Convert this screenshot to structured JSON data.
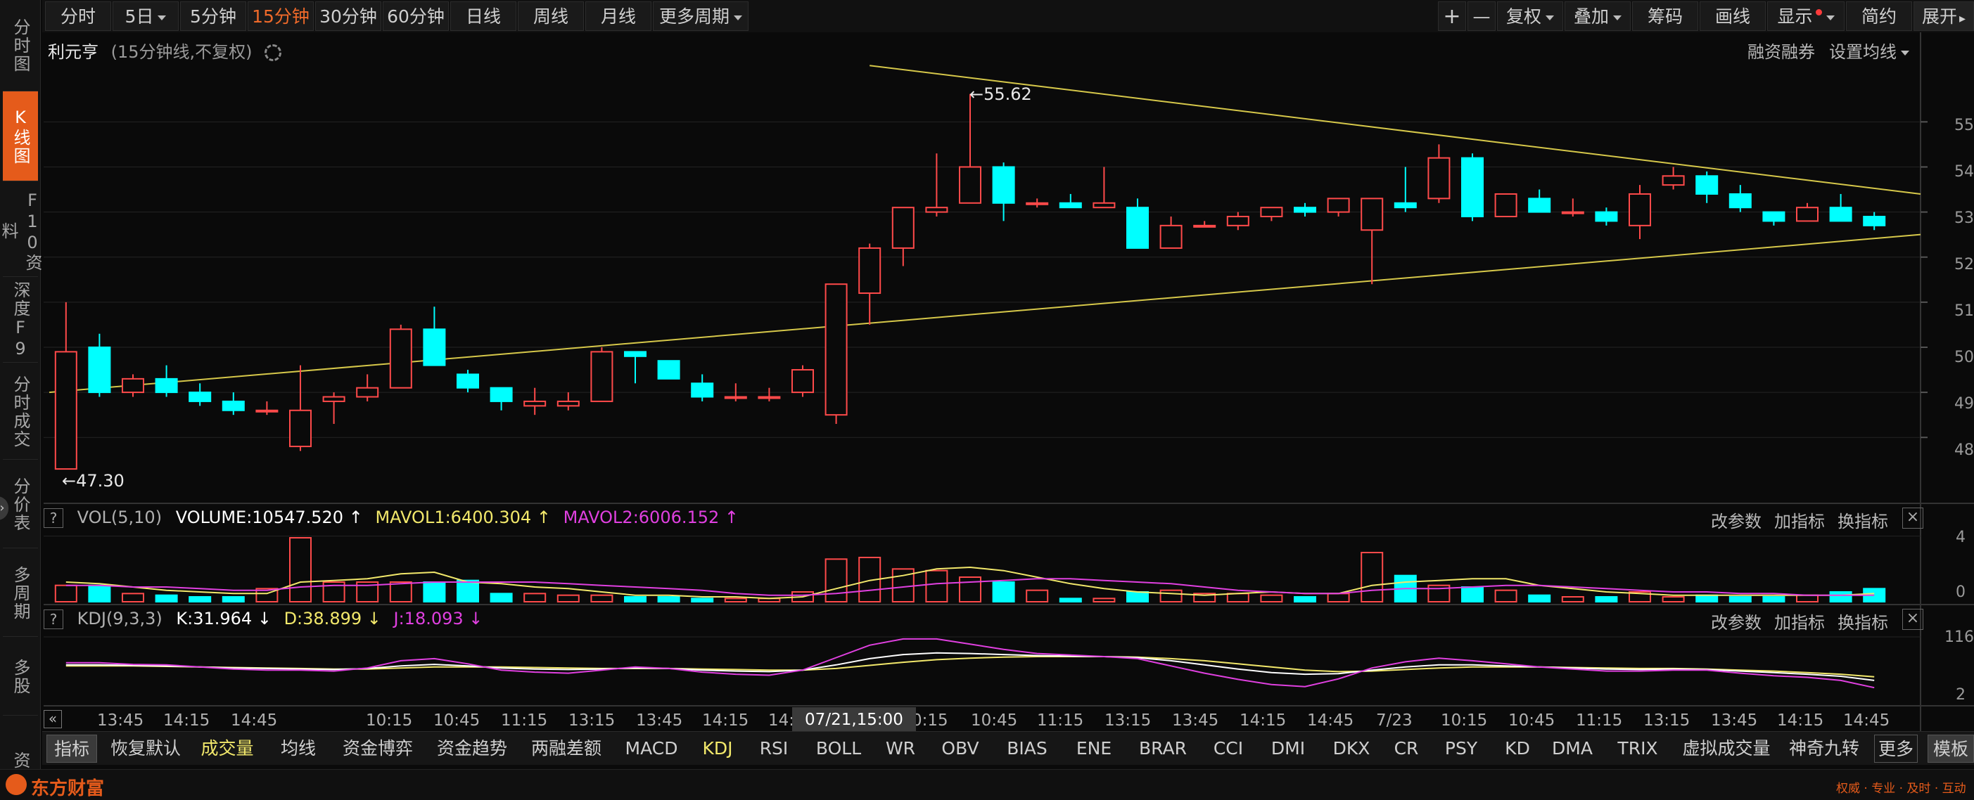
{
  "nav": {
    "items": [
      {
        "label": "分时图"
      },
      {
        "label": "K线图"
      },
      {
        "label": "F10资料"
      },
      {
        "label": "深度F9"
      },
      {
        "label": "分时成交"
      },
      {
        "label": "分价表"
      },
      {
        "label": "多周期"
      },
      {
        "label": "多股"
      },
      {
        "label": "资"
      }
    ]
  },
  "toolbar": {
    "periods": [
      "分时",
      "5日",
      "5分钟",
      "15分钟",
      "30分钟",
      "60分钟",
      "日线",
      "周线",
      "月线",
      "更多周期"
    ],
    "active_period": "15分钟",
    "plus": "+",
    "minus": "—",
    "fuquan": "复权",
    "diejia": "叠加",
    "chouma": "筹码",
    "huaxian": "画线",
    "xianshi": "显示",
    "jianyue": "简约",
    "zhankai": "展开"
  },
  "header": {
    "stock_name": "利元亨",
    "desc": "(15分钟线,不复权)",
    "margin_link": "融资融券",
    "ma_setting": "设置均线"
  },
  "price_axis": [
    "55",
    "54",
    "53",
    "52",
    "51",
    "50",
    "49",
    "48"
  ],
  "annotations": {
    "high": "55.62",
    "low": "47.30"
  },
  "volume_panel": {
    "help": "?",
    "name": "VOL(5,10)",
    "volume": "VOLUME:10547.520",
    "mavol1": "MAVOL1:6400.304",
    "mavol2": "MAVOL2:6006.152",
    "axis_top": "4",
    "axis_bottom": "0",
    "actions": [
      "改参数",
      "加指标",
      "换指标"
    ],
    "close": "×"
  },
  "kdj_panel": {
    "help": "?",
    "name": "KDJ(9,3,3)",
    "k": "K:31.964",
    "d": "D:38.899",
    "j": "J:18.093",
    "axis_top": "116",
    "axis_bottom": "2",
    "actions": [
      "改参数",
      "加指标",
      "换指标"
    ],
    "close": "×"
  },
  "time_axis": {
    "labels": [
      "13:45",
      "14:15",
      "14:45",
      "10:15",
      "10:45",
      "11:15",
      "13:15",
      "13:45",
      "14:15",
      "14:",
      "0:15",
      "10:45",
      "11:15",
      "13:15",
      "13:45",
      "14:15",
      "14:45",
      "7/23",
      "10:15",
      "10:45",
      "11:15",
      "13:15",
      "13:45",
      "14:15",
      "14:45"
    ],
    "cursor_time": "07/21,15:00",
    "collapse": "«"
  },
  "indicators": {
    "items": [
      "指标",
      "恢复默认",
      "成交量",
      "均线",
      "资金博弈",
      "资金趋势",
      "两融差额",
      "MACD",
      "KDJ",
      "RSI",
      "BOLL",
      "WR",
      "OBV",
      "BIAS",
      "ENE",
      "BRAR",
      "CCI",
      "DMI",
      "DKX",
      "CR",
      "PSY",
      "KD",
      "DMA",
      "TRIX",
      "虚拟成交量",
      "神奇九转",
      "更多",
      "模板"
    ]
  },
  "footer": {
    "brand": "东方财富",
    "slogan": "权威 · 专业 · 及时 · 互动"
  },
  "chart_data": {
    "type": "candlestick",
    "interval": "15分钟",
    "ylim": [
      46.6,
      56.3
    ],
    "candles": [
      {
        "o": 47.3,
        "h": 51.0,
        "l": 47.3,
        "c": 49.9
      },
      {
        "o": 50.0,
        "h": 50.3,
        "l": 48.9,
        "c": 49.0
      },
      {
        "o": 49.0,
        "h": 49.4,
        "l": 48.9,
        "c": 49.3
      },
      {
        "o": 49.3,
        "h": 49.6,
        "l": 48.9,
        "c": 49.0
      },
      {
        "o": 49.0,
        "h": 49.2,
        "l": 48.7,
        "c": 48.8
      },
      {
        "o": 48.8,
        "h": 49.0,
        "l": 48.5,
        "c": 48.6
      },
      {
        "o": 48.6,
        "h": 48.8,
        "l": 48.5,
        "c": 48.6
      },
      {
        "o": 47.8,
        "h": 49.6,
        "l": 47.7,
        "c": 48.6
      },
      {
        "o": 48.8,
        "h": 49.0,
        "l": 48.3,
        "c": 48.9
      },
      {
        "o": 48.9,
        "h": 49.4,
        "l": 48.8,
        "c": 49.1
      },
      {
        "o": 49.1,
        "h": 50.5,
        "l": 49.1,
        "c": 50.4
      },
      {
        "o": 50.4,
        "h": 50.9,
        "l": 49.6,
        "c": 49.6
      },
      {
        "o": 49.4,
        "h": 49.5,
        "l": 49.0,
        "c": 49.1
      },
      {
        "o": 49.1,
        "h": 49.1,
        "l": 48.6,
        "c": 48.8
      },
      {
        "o": 48.7,
        "h": 49.1,
        "l": 48.5,
        "c": 48.8
      },
      {
        "o": 48.7,
        "h": 49.0,
        "l": 48.6,
        "c": 48.8
      },
      {
        "o": 48.8,
        "h": 50.0,
        "l": 48.8,
        "c": 49.9
      },
      {
        "o": 49.9,
        "h": 49.9,
        "l": 49.2,
        "c": 49.8
      },
      {
        "o": 49.7,
        "h": 49.7,
        "l": 49.3,
        "c": 49.3
      },
      {
        "o": 49.2,
        "h": 49.4,
        "l": 48.8,
        "c": 48.9
      },
      {
        "o": 48.9,
        "h": 49.2,
        "l": 48.8,
        "c": 48.9
      },
      {
        "o": 48.9,
        "h": 49.1,
        "l": 48.8,
        "c": 48.9
      },
      {
        "o": 49.0,
        "h": 49.6,
        "l": 48.9,
        "c": 49.5
      },
      {
        "o": 48.5,
        "h": 51.4,
        "l": 48.3,
        "c": 51.4
      },
      {
        "o": 51.2,
        "h": 52.3,
        "l": 50.5,
        "c": 52.2
      },
      {
        "o": 52.2,
        "h": 53.1,
        "l": 51.8,
        "c": 53.1
      },
      {
        "o": 53.0,
        "h": 54.3,
        "l": 52.9,
        "c": 53.1
      },
      {
        "o": 53.2,
        "h": 55.62,
        "l": 53.2,
        "c": 54.0
      },
      {
        "o": 54.0,
        "h": 54.1,
        "l": 52.8,
        "c": 53.2
      },
      {
        "o": 53.2,
        "h": 53.3,
        "l": 53.1,
        "c": 53.2
      },
      {
        "o": 53.2,
        "h": 53.4,
        "l": 53.1,
        "c": 53.1
      },
      {
        "o": 53.1,
        "h": 54.0,
        "l": 53.1,
        "c": 53.2
      },
      {
        "o": 53.1,
        "h": 53.3,
        "l": 52.2,
        "c": 52.2
      },
      {
        "o": 52.2,
        "h": 52.9,
        "l": 52.2,
        "c": 52.7
      },
      {
        "o": 52.7,
        "h": 52.8,
        "l": 52.7,
        "c": 52.7
      },
      {
        "o": 52.7,
        "h": 53.0,
        "l": 52.6,
        "c": 52.9
      },
      {
        "o": 52.9,
        "h": 53.1,
        "l": 52.8,
        "c": 53.1
      },
      {
        "o": 53.1,
        "h": 53.2,
        "l": 52.9,
        "c": 53.0
      },
      {
        "o": 53.0,
        "h": 53.3,
        "l": 52.9,
        "c": 53.3
      },
      {
        "o": 52.6,
        "h": 53.3,
        "l": 51.4,
        "c": 53.3
      },
      {
        "o": 53.2,
        "h": 54.0,
        "l": 53.0,
        "c": 53.1
      },
      {
        "o": 53.3,
        "h": 54.5,
        "l": 53.2,
        "c": 54.2
      },
      {
        "o": 54.2,
        "h": 54.3,
        "l": 52.8,
        "c": 52.9
      },
      {
        "o": 52.9,
        "h": 53.4,
        "l": 52.9,
        "c": 53.4
      },
      {
        "o": 53.3,
        "h": 53.5,
        "l": 53.0,
        "c": 53.0
      },
      {
        "o": 53.0,
        "h": 53.3,
        "l": 52.9,
        "c": 53.0
      },
      {
        "o": 53.0,
        "h": 53.1,
        "l": 52.7,
        "c": 52.8
      },
      {
        "o": 52.7,
        "h": 53.6,
        "l": 52.4,
        "c": 53.4
      },
      {
        "o": 53.6,
        "h": 54.0,
        "l": 53.5,
        "c": 53.8
      },
      {
        "o": 53.8,
        "h": 53.9,
        "l": 53.2,
        "c": 53.4
      },
      {
        "o": 53.4,
        "h": 53.6,
        "l": 53.0,
        "c": 53.1
      },
      {
        "o": 53.0,
        "h": 53.0,
        "l": 52.7,
        "c": 52.8
      },
      {
        "o": 52.8,
        "h": 53.2,
        "l": 52.8,
        "c": 53.1
      },
      {
        "o": 53.1,
        "h": 53.4,
        "l": 52.8,
        "c": 52.8
      },
      {
        "o": 52.9,
        "h": 53.0,
        "l": 52.6,
        "c": 52.7
      }
    ],
    "trendlines": [
      {
        "from": {
          "i": -0.5,
          "p": 49.0
        },
        "to": {
          "i": 55.5,
          "p": 52.5
        }
      },
      {
        "from": {
          "i": 24,
          "p": 56.25
        },
        "to": {
          "i": 55.5,
          "p": 53.4
        }
      }
    ],
    "volume": {
      "values": [
        1.0,
        1.0,
        0.5,
        0.4,
        0.3,
        0.3,
        0.8,
        3.9,
        1.2,
        1.2,
        1.2,
        1.2,
        1.3,
        0.5,
        0.5,
        0.4,
        0.4,
        0.3,
        0.3,
        0.2,
        0.2,
        0.2,
        0.6,
        2.6,
        2.7,
        2.0,
        1.9,
        1.5,
        1.2,
        0.7,
        0.2,
        0.2,
        0.6,
        0.7,
        0.5,
        0.5,
        0.4,
        0.3,
        0.5,
        3.0,
        1.6,
        1.0,
        0.9,
        0.7,
        0.4,
        0.3,
        0.3,
        0.6,
        0.3,
        0.4,
        0.3,
        0.3,
        0.4,
        0.6,
        0.8
      ],
      "ma5": [
        1.2,
        1.1,
        0.9,
        0.7,
        0.6,
        0.5,
        0.5,
        1.2,
        1.3,
        1.4,
        1.7,
        1.8,
        1.2,
        1.1,
        0.9,
        0.8,
        0.6,
        0.4,
        0.4,
        0.3,
        0.3,
        0.2,
        0.3,
        0.8,
        1.3,
        1.6,
        2.0,
        2.1,
        1.9,
        1.5,
        1.1,
        0.8,
        0.6,
        0.5,
        0.4,
        0.5,
        0.6,
        0.5,
        0.5,
        1.0,
        1.2,
        1.3,
        1.4,
        1.4,
        1.0,
        0.8,
        0.6,
        0.5,
        0.4,
        0.4,
        0.4,
        0.4,
        0.4,
        0.4,
        0.5
      ],
      "ma10": [
        1.0,
        1.0,
        0.9,
        0.9,
        0.8,
        0.7,
        0.7,
        0.9,
        1.0,
        1.0,
        1.1,
        1.2,
        1.2,
        1.2,
        1.2,
        1.1,
        1.0,
        0.9,
        0.8,
        0.7,
        0.5,
        0.4,
        0.4,
        0.5,
        0.7,
        0.9,
        1.1,
        1.2,
        1.3,
        1.4,
        1.4,
        1.3,
        1.2,
        1.1,
        0.9,
        0.7,
        0.6,
        0.5,
        0.5,
        0.7,
        0.8,
        0.8,
        0.9,
        1.0,
        1.0,
        0.9,
        0.8,
        0.7,
        0.6,
        0.6,
        0.5,
        0.5,
        0.4,
        0.4,
        0.4
      ],
      "ylim": [
        0,
        4.2
      ]
    },
    "kdj": {
      "k": [
        62,
        62,
        61,
        60,
        58,
        56,
        55,
        54,
        53,
        55,
        60,
        63,
        60,
        56,
        54,
        53,
        54,
        56,
        55,
        52,
        50,
        49,
        52,
        62,
        74,
        82,
        85,
        84,
        82,
        80,
        79,
        78,
        76,
        70,
        62,
        54,
        47,
        44,
        45,
        52,
        58,
        62,
        62,
        60,
        58,
        56,
        54,
        53,
        54,
        53,
        50,
        47,
        44,
        40,
        32
      ],
      "d": [
        60,
        60,
        60,
        59,
        58,
        57,
        56,
        55,
        54,
        54,
        56,
        58,
        58,
        58,
        57,
        56,
        55,
        55,
        55,
        54,
        53,
        52,
        52,
        55,
        61,
        67,
        72,
        75,
        77,
        78,
        78,
        78,
        77,
        74,
        70,
        64,
        58,
        52,
        49,
        50,
        53,
        56,
        58,
        58,
        58,
        57,
        56,
        55,
        55,
        54,
        52,
        50,
        47,
        44,
        39
      ],
      "j": [
        66,
        66,
        63,
        62,
        58,
        54,
        52,
        52,
        50,
        56,
        70,
        74,
        64,
        52,
        48,
        46,
        52,
        58,
        55,
        48,
        44,
        42,
        52,
        76,
        100,
        112,
        112,
        102,
        92,
        84,
        81,
        78,
        74,
        60,
        46,
        34,
        24,
        20,
        35,
        56,
        68,
        75,
        70,
        64,
        58,
        54,
        50,
        50,
        52,
        52,
        46,
        41,
        38,
        32,
        18
      ],
      "ylim": [
        2,
        116
      ]
    },
    "colors": {
      "up": "#ff4a4a",
      "down": "#00ffff",
      "trend": "#d6c84a",
      "ma1": "#f2e86b",
      "ma2": "#e040e0",
      "k": "#ffffff",
      "d": "#f2e86b",
      "j": "#e040e0"
    }
  }
}
